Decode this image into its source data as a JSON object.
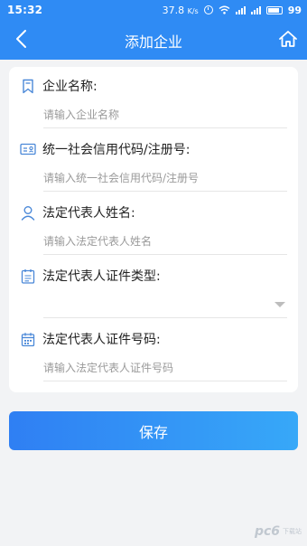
{
  "status_bar": {
    "time": "15:32",
    "network_speed": "37.8",
    "network_unit": "K/s",
    "battery": "99"
  },
  "header": {
    "title": "添加企业"
  },
  "form": {
    "fields": [
      {
        "label": "企业名称:",
        "placeholder": "请输入企业名称",
        "value": "",
        "icon": "bookmark-icon"
      },
      {
        "label": "统一社会信用代码/注册号:",
        "placeholder": "请输入统一社会信用代码/注册号",
        "value": "",
        "icon": "id-card-icon"
      },
      {
        "label": "法定代表人姓名:",
        "placeholder": "请输入法定代表人姓名",
        "value": "",
        "icon": "person-icon"
      },
      {
        "label": "法定代表人证件类型:",
        "placeholder": "",
        "value": "",
        "icon": "clipboard-icon"
      },
      {
        "label": "法定代表人证件号码:",
        "placeholder": "请输入法定代表人证件号码",
        "value": "",
        "icon": "calendar-icon"
      }
    ]
  },
  "actions": {
    "save_label": "保存"
  },
  "watermark": {
    "brand": "pc6",
    "text": "下载站"
  },
  "colors": {
    "primary": "#2f8bf4",
    "icon": "#4a88d8"
  }
}
